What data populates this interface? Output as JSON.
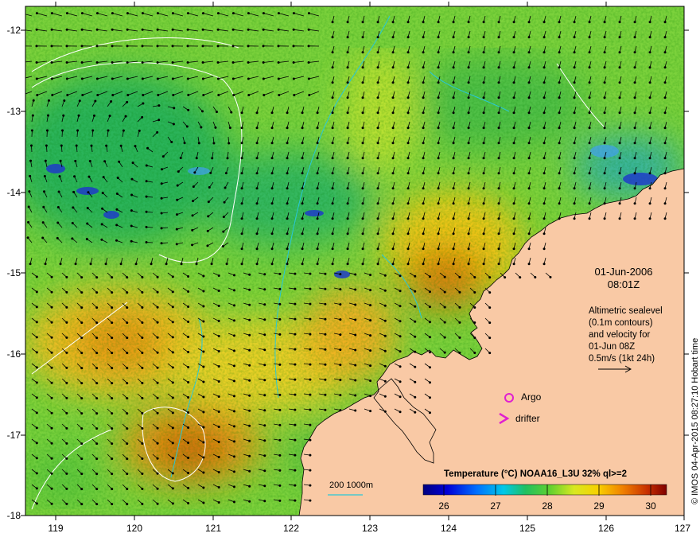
{
  "map": {
    "y_axis_ticks": [
      "-12",
      "-13",
      "-14",
      "-15",
      "-16",
      "-17",
      "-18"
    ],
    "x_axis_ticks": [
      "119",
      "120",
      "121",
      "122",
      "123",
      "124",
      "125",
      "126",
      "127"
    ],
    "lon_range": [
      118.65,
      127.0
    ],
    "lat_range": [
      -18.0,
      -11.7
    ],
    "land_color": "#f9c9a5",
    "contour_color": "#ffffff",
    "isobath_color": "#28c8d8",
    "vector_color": "#000000"
  },
  "date_label": {
    "date": "01-Jun-2006",
    "time": "08:01Z"
  },
  "info_text": {
    "line1": "Altimetric sealevel",
    "line2": "(0.1m contours)",
    "line3": "and velocity for",
    "line4": "01-Jun 08Z",
    "line5": "0.5m/s (1kt 24h)"
  },
  "legend": {
    "argo": "Argo",
    "drifter": "drifter",
    "argo_color": "#e020d0",
    "drifter_color": "#e020d0",
    "depth_label": "200  1000m"
  },
  "colorbar": {
    "title": "Temperature (°C) NOAA16_L3U 32% ql>=2",
    "ticks": [
      "26",
      "27",
      "28",
      "29",
      "30"
    ],
    "range": [
      25.6,
      30.4
    ]
  },
  "credit": "© IMOS 04-Apr-2015 08:27:10 Hobart time"
}
